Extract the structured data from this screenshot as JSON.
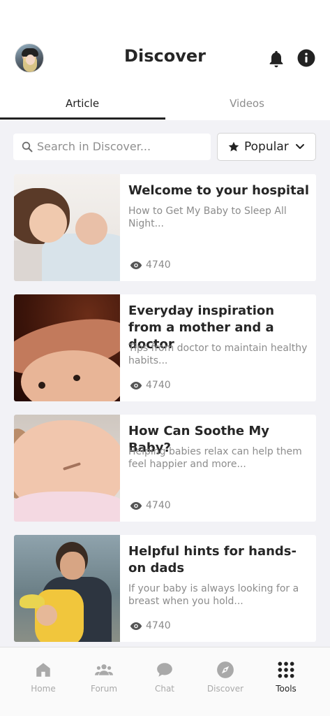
{
  "header": {
    "title": "Discover"
  },
  "tabs": [
    {
      "label": "Article",
      "active": true
    },
    {
      "label": "Videos",
      "active": false
    }
  ],
  "search": {
    "placeholder": "Search in Discover..."
  },
  "filter": {
    "selected": "Popular"
  },
  "articles": [
    {
      "title": "Welcome to your hospital",
      "description": "How to Get My Baby to Sleep All Night...",
      "views": "4740"
    },
    {
      "title": "Everyday inspiration from a mother and a doctor",
      "description": "Tips from doctor to maintain healthy habits...",
      "views": "4740"
    },
    {
      "title": "How Can Soothe My Baby?",
      "description": "Helping babies relax can help them feel happier and more...",
      "views": "4740"
    },
    {
      "title": "Helpful hints for hands-on dads",
      "description": "If your baby is always looking for a breast when you hold...",
      "views": "4740"
    }
  ],
  "bottom_nav": [
    {
      "label": "Home",
      "icon": "home-icon",
      "active": false
    },
    {
      "label": "Forum",
      "icon": "people-icon",
      "active": false
    },
    {
      "label": "Chat",
      "icon": "chat-bubble-icon",
      "active": false
    },
    {
      "label": "Discover",
      "icon": "compass-icon",
      "active": false
    },
    {
      "label": "Tools",
      "icon": "grid-dots-icon",
      "active": true
    }
  ],
  "colors": {
    "accent": "#222222",
    "background": "#f2f2f6",
    "muted_text": "#8c8c8c",
    "inactive_nav": "#a9a9a9"
  }
}
